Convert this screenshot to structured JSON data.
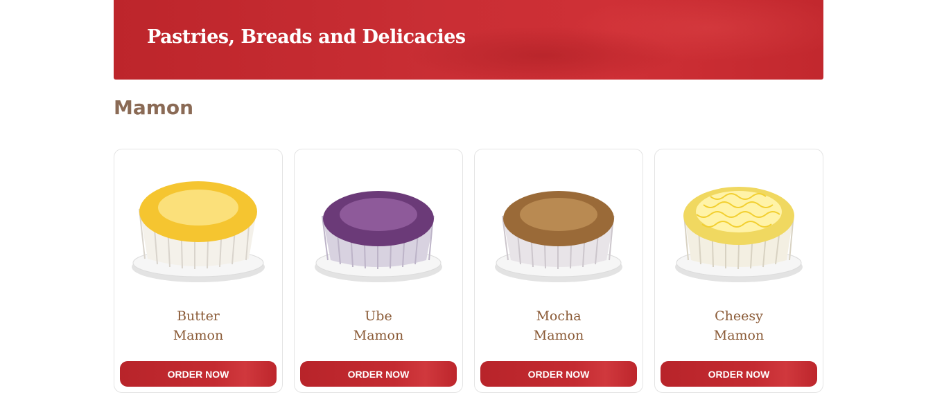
{
  "banner": {
    "title": "Pastries, Breads and Delicacies"
  },
  "section": {
    "title": "Mamon"
  },
  "products": [
    {
      "name_line1": "Butter",
      "name_line2": "Mamon",
      "button": "ORDER NOW",
      "icon": "butter-mamon-image",
      "cake_color": "#f5c530",
      "cake_light": "#fbe07a"
    },
    {
      "name_line1": "Ube",
      "name_line2": "Mamon",
      "button": "ORDER NOW",
      "icon": "ube-mamon-image",
      "cake_color": "#6b3a78",
      "cake_light": "#8e5a9a"
    },
    {
      "name_line1": "Mocha",
      "name_line2": "Mamon",
      "button": "ORDER NOW",
      "icon": "mocha-mamon-image",
      "cake_color": "#9a6a38",
      "cake_light": "#b98a52"
    },
    {
      "name_line1": "Cheesy",
      "name_line2": "Mamon",
      "button": "ORDER NOW",
      "icon": "cheesy-mamon-image",
      "cake_color": "#f0d860",
      "cake_light": "#fff3a8"
    }
  ]
}
